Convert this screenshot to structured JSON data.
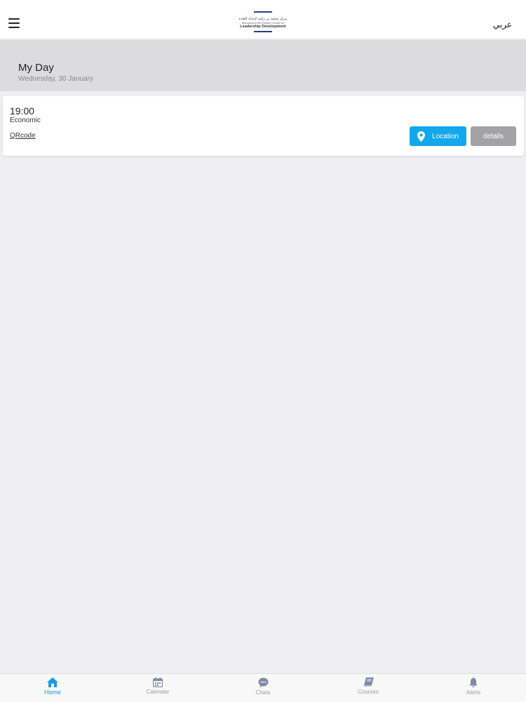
{
  "header": {
    "logo_arabic": "مركز محمد بن راشد لإعداد القادة",
    "logo_english_line1": "Mohammed Bin Rashid Center for",
    "logo_english_line2": "Leadership Development",
    "language_toggle": "عربي"
  },
  "page": {
    "title": "My Day",
    "date": "Wednesday, 30 January"
  },
  "events": [
    {
      "time": "19:00",
      "course": "Economic",
      "qr_link": "QRcode",
      "location_button": "Location",
      "details_button": "details"
    }
  ],
  "tabs": [
    {
      "label": "Home",
      "icon": "home-icon",
      "active": true
    },
    {
      "label": "Calendar",
      "icon": "calendar-icon",
      "active": false
    },
    {
      "label": "Chats",
      "icon": "chat-icon",
      "active": false
    },
    {
      "label": "Courses",
      "icon": "book-icon",
      "active": false
    },
    {
      "label": "Alerts",
      "icon": "bell-icon",
      "active": false
    }
  ],
  "colors": {
    "accent": "#13a8ec",
    "active_tab": "#1d9ce0",
    "inactive_tab": "#9a9a9e",
    "details_button": "#a3a3a6",
    "logo_blue": "#2d3e7a"
  }
}
